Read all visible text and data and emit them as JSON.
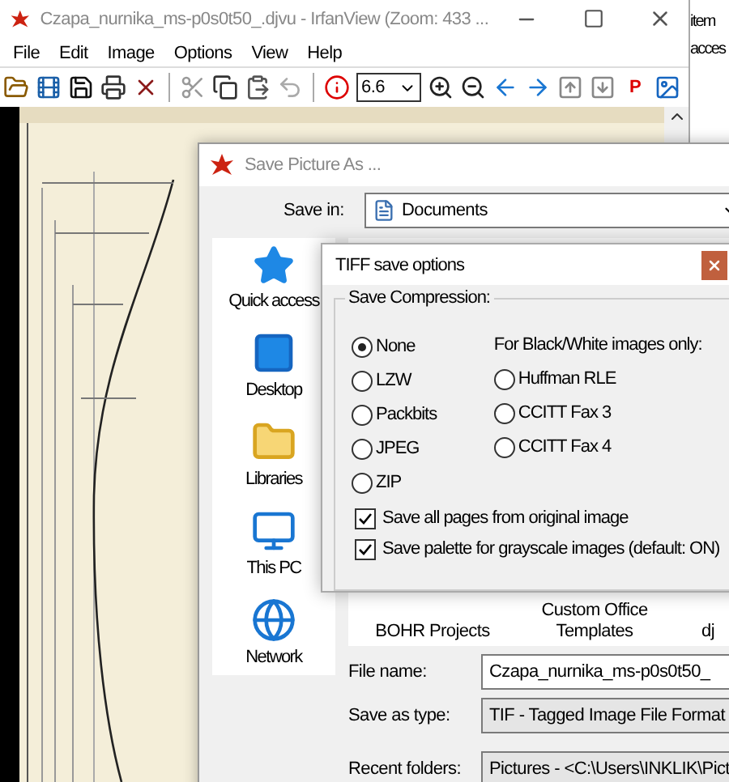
{
  "background_window": {
    "texts": [
      "item",
      "acces"
    ]
  },
  "irfanview": {
    "title": "Czapa_nurnika_ms-p0s0t50_.djvu - IrfanView (Zoom: 433 ...",
    "menu": [
      "File",
      "Edit",
      "Image",
      "Options",
      "View",
      "Help"
    ],
    "zoom_value": "6.6",
    "p_button": "P"
  },
  "save_dialog": {
    "title": "Save Picture As ...",
    "save_in_label": "Save in:",
    "save_in_value": "Documents",
    "places": [
      "Quick access",
      "Desktop",
      "Libraries",
      "This PC",
      "Network"
    ],
    "files": [
      "BOHR Projects",
      "Custom Office Templates",
      "dj"
    ],
    "fields": [
      {
        "label": "File name:",
        "value": "Czapa_nurnika_ms-p0s0t50_",
        "kind": "input"
      },
      {
        "label": "Save as type:",
        "value": "TIF - Tagged Image File Format",
        "kind": "select"
      },
      {
        "label": "Recent folders:",
        "value": "Pictures  -  <C:\\Users\\INKLIK\\Pict",
        "kind": "select"
      }
    ]
  },
  "tiff_dialog": {
    "title": "TIFF save options",
    "group_label": "Save Compression:",
    "bw_label": "For Black/White images only:",
    "compression": [
      {
        "label": "None",
        "selected": true
      },
      {
        "label": "LZW",
        "selected": false
      },
      {
        "label": "Packbits",
        "selected": false
      },
      {
        "label": "JPEG",
        "selected": false
      },
      {
        "label": "ZIP",
        "selected": false
      }
    ],
    "bw_compression": [
      {
        "label": "Huffman RLE",
        "selected": false
      },
      {
        "label": "CCITT Fax 3",
        "selected": false
      },
      {
        "label": "CCITT Fax 4",
        "selected": false
      }
    ],
    "checkboxes": [
      {
        "label": "Save all pages from original image",
        "checked": true
      },
      {
        "label": "Save palette for grayscale images (default: ON)",
        "checked": true
      }
    ]
  }
}
